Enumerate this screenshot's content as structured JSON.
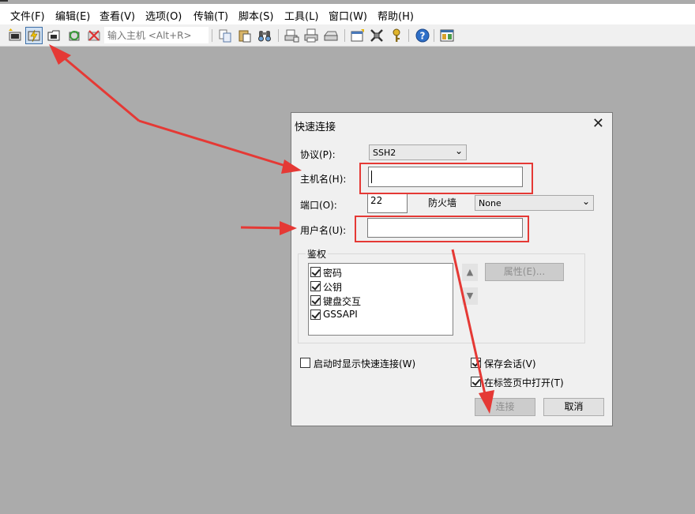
{
  "menu": [
    "文件(F)",
    "编辑(E)",
    "查看(V)",
    "选项(O)",
    "传输(T)",
    "脚本(S)",
    "工具(L)",
    "窗口(W)",
    "帮助(H)"
  ],
  "toolbar": {
    "host_placeholder": "输入主机 <Alt+R>",
    "icons": [
      "connect-icon",
      "quick-connect-icon",
      "connect-tab-icon",
      "reconnect-icon",
      "disconnect-icon",
      "copy-icon",
      "paste-icon",
      "find-icon",
      "print-setup-icon",
      "print-icon",
      "printer-icon",
      "session-options-icon",
      "keymap-icon",
      "key-agent-icon",
      "help-icon",
      "about-icon"
    ]
  },
  "dialog": {
    "title": "快速连接",
    "protocol_label": "协议(P):",
    "protocol_value": "SSH2",
    "hostname_label": "主机名(H):",
    "hostname_value": "",
    "port_label": "端口(O):",
    "port_value": "22",
    "firewall_label": "防火墙",
    "firewall_value": "None",
    "username_label": "用户名(U):",
    "username_value": "",
    "auth_group_label": "鉴权",
    "auth_items": [
      {
        "label": "密码",
        "checked": true
      },
      {
        "label": "公钥",
        "checked": true
      },
      {
        "label": "键盘交互",
        "checked": true
      },
      {
        "label": "GSSAPI",
        "checked": true
      }
    ],
    "properties_button": "属性(E)...",
    "show_on_startup_label": "启动时显示快速连接(W)",
    "save_session_label": "保存会话(V)",
    "open_in_tab_label": "在标签页中打开(T)",
    "connect_button": "连接",
    "cancel_button": "取消"
  },
  "colors": {
    "annotation": "#e53935",
    "background": "#ababab"
  }
}
